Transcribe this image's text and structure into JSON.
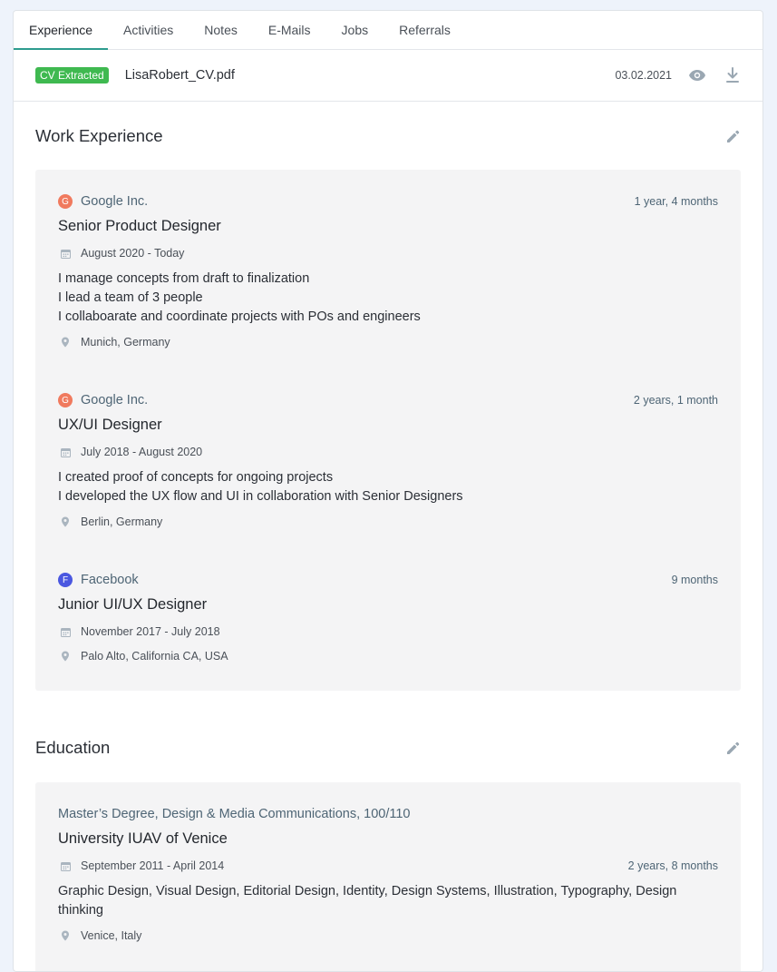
{
  "tabs": [
    "Experience",
    "Activities",
    "Notes",
    "E-Mails",
    "Jobs",
    "Referrals"
  ],
  "file": {
    "badge": "CV Extracted",
    "name": "LisaRobert_CV.pdf",
    "date": "03.02.2021",
    "view_icon": "eye-icon",
    "download_icon": "download-icon"
  },
  "colors": {
    "accent": "#2d9c8e",
    "badge": "#3fb950",
    "google": "#f07a5e",
    "facebook": "#4a57e0"
  },
  "work": {
    "title": "Work Experience",
    "edit_icon": "pencil-icon",
    "entries": [
      {
        "logo_letter": "G",
        "company": "Google Inc.",
        "duration": "1 year, 4 months",
        "role": "Senior Product Designer",
        "dates": "August 2020 - Today",
        "description": [
          "I manage concepts from draft to finalization",
          "I lead a team of 3 people",
          "I collaboarate and coordinate projects with POs and engineers"
        ],
        "location": "Munich, Germany"
      },
      {
        "logo_letter": "G",
        "company": "Google Inc.",
        "duration": "2 years, 1 month",
        "role": "UX/UI Designer",
        "dates": "July 2018 - August 2020",
        "description": [
          "I created proof of concepts for ongoing projects",
          "I developed the UX flow and UI in collaboration with Senior Designers"
        ],
        "location": "Berlin, Germany"
      },
      {
        "logo_letter": "F",
        "company": "Facebook",
        "duration": "9 months",
        "role": "Junior UI/UX Designer",
        "dates": "November 2017 - July 2018",
        "location": "Palo Alto, California CA, USA"
      }
    ]
  },
  "education": {
    "title": "Education",
    "edit_icon": "pencil-icon",
    "entries": [
      {
        "degree": "Master’s Degree, Design & Media Communications, 100/110",
        "school": "University IUAV of Venice",
        "dates": "September 2011 - April 2014",
        "duration": "2 years, 8 months",
        "description": [
          "Graphic Design, Visual Design, Editorial Design, Identity, Design Systems, Illustration, Typography, Design",
          "thinking"
        ],
        "location": "Venice, Italy"
      }
    ]
  }
}
